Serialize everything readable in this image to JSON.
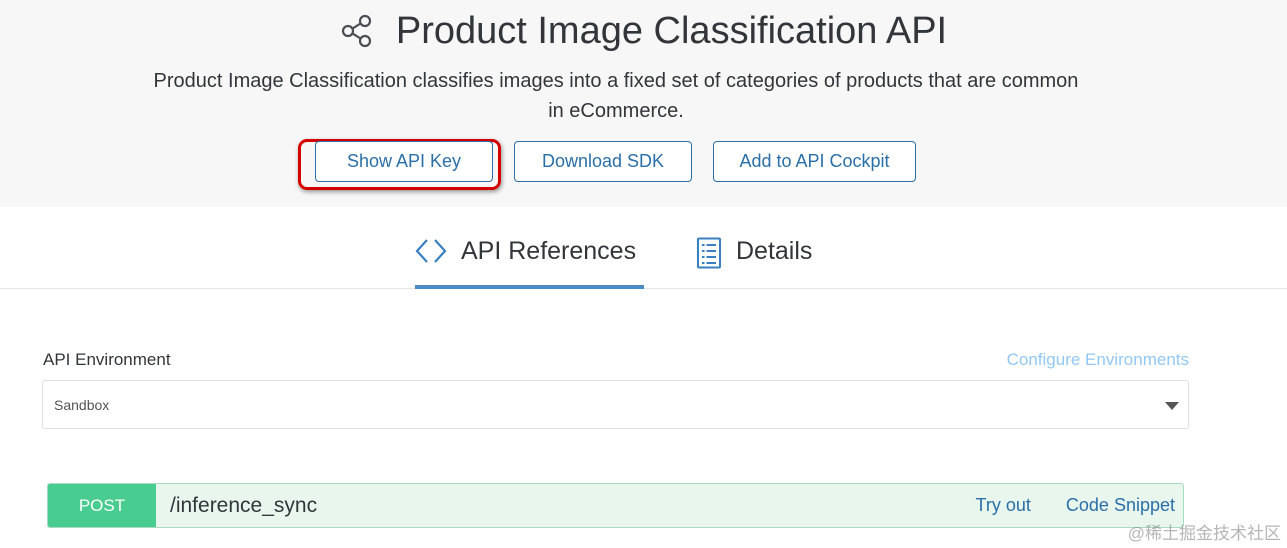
{
  "header": {
    "title": "Product Image Classification API",
    "icon": "share-icon",
    "description": "Product Image Classification classifies images into a fixed set of categories of products that are common in eCommerce."
  },
  "actions": {
    "show_api_key": "Show API Key",
    "download_sdk": "Download SDK",
    "add_to_cockpit": "Add to API Cockpit"
  },
  "tabs": [
    {
      "label": "API References",
      "icon": "code-icon",
      "active": true
    },
    {
      "label": "Details",
      "icon": "document-icon",
      "active": false
    }
  ],
  "environment": {
    "label": "API Environment",
    "configure_link": "Configure Environments",
    "selected": "Sandbox"
  },
  "endpoint": {
    "method": "POST",
    "path": "/inference_sync",
    "try_out": "Try out",
    "code_snippet": "Code Snippet"
  },
  "colors": {
    "accent": "#2a6fa8",
    "post_method": "#49cc90",
    "highlight": "#d40000"
  },
  "watermark": "@稀土掘金技术社区"
}
